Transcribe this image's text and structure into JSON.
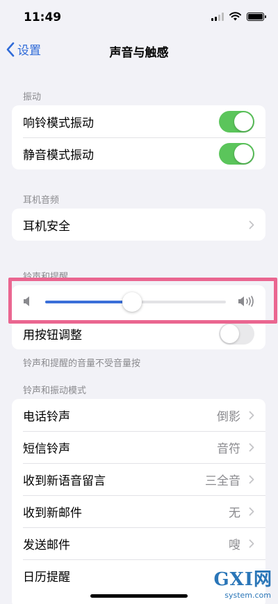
{
  "status_bar": {
    "time": "11:49"
  },
  "nav": {
    "back_label": "设置",
    "title": "声音与触感"
  },
  "sections": {
    "vibration": {
      "label": "振动",
      "rows": [
        {
          "label": "响铃模式振动",
          "toggle_on": true
        },
        {
          "label": "静音模式振动",
          "toggle_on": true
        }
      ]
    },
    "headphone": {
      "label": "耳机音频",
      "rows": [
        {
          "label": "耳机安全"
        }
      ]
    },
    "ringer": {
      "label": "铃声和提醒",
      "volume_level": 0.48,
      "rows": [
        {
          "label": "用按钮调整",
          "toggle_on": false
        }
      ],
      "note": "铃声和提醒的音量不受音量按"
    },
    "patterns": {
      "label": "铃声和振动模式",
      "rows": [
        {
          "label": "电话铃声",
          "value": "倒影"
        },
        {
          "label": "短信铃声",
          "value": "音符"
        },
        {
          "label": "收到新语音留言",
          "value": "三全音"
        },
        {
          "label": "收到新邮件",
          "value": "无"
        },
        {
          "label": "发送邮件",
          "value": "嗖"
        },
        {
          "label": "日历提醒",
          "value": ""
        }
      ]
    }
  },
  "watermark": {
    "brand": "GXI网",
    "url": "system.com"
  },
  "colors": {
    "accent": "#2f6bd8",
    "toggle_on": "#5bc55b",
    "highlight": "#ea6690"
  }
}
